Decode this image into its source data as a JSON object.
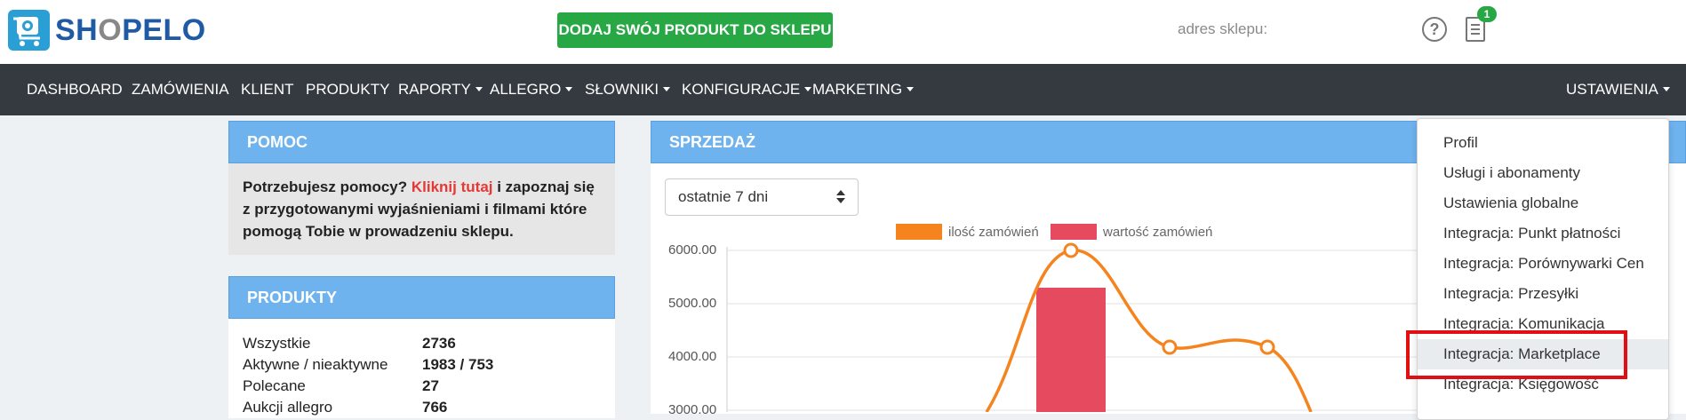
{
  "header": {
    "logo_text_a": "SH",
    "logo_text_b": "O",
    "logo_text_c": "PELO",
    "add_product_label": "DODAJ SWÓJ PRODUKT DO SKLEPU",
    "shop_address_label": "adres sklepu:",
    "notification_count": "1"
  },
  "nav": {
    "items": [
      "DASHBOARD",
      "ZAMÓWIENIA",
      "KLIENT",
      "PRODUKTY",
      "RAPORTY",
      "ALLEGRO",
      "SŁOWNIKI",
      "KONFIGURACJE",
      "MARKETING"
    ],
    "settings_label": "USTAWIENIA"
  },
  "help_panel": {
    "title": "POMOC",
    "text_before": "Potrzebujesz pomocy? ",
    "link_text": "Kliknij tutaj",
    "text_after": " i zapoznaj się z przygotowanymi wyjaśnieniami i filmami które pomogą Tobie w prowadzeniu sklepu."
  },
  "products_panel": {
    "title": "PRODUKTY",
    "rows": [
      {
        "label": "Wszystkie",
        "value": "2736"
      },
      {
        "label": "Aktywne / nieaktywne",
        "value": "1983 / 753"
      },
      {
        "label": "Polecane",
        "value": "27"
      },
      {
        "label": "Aukcji allegro",
        "value": "766"
      }
    ]
  },
  "sales_panel": {
    "title": "SPRZEDAŻ",
    "period_selected": "ostatnie 7 dni"
  },
  "chart_data": {
    "type": "line",
    "series": [
      {
        "name": "ilość zamówień",
        "color": "#f5841f"
      },
      {
        "name": "wartość zamówień",
        "color": "#e64a5e",
        "values": [
          5300
        ]
      }
    ],
    "yticks": [
      "6000.00",
      "5000.00",
      "4000.00",
      "3000.00"
    ],
    "ylim": [
      3000,
      6000
    ]
  },
  "settings_menu": {
    "items": [
      "Profil",
      "Usługi i abonamenty",
      "Ustawienia globalne",
      "Integracja: Punkt płatności",
      "Integracja: Porównywarki Cen",
      "Integracja: Przesyłki",
      "Integracja: Komunikacja",
      "Integracja: Marketplace",
      "Integracja: Księgowość"
    ],
    "highlighted_item": "Integracja: Marketplace"
  },
  "colors": {
    "brand_blue": "#1f5aa5",
    "green": "#28a745",
    "navbar": "#343a40",
    "panel_header": "#6eb2ee",
    "link_red": "#e53935"
  }
}
